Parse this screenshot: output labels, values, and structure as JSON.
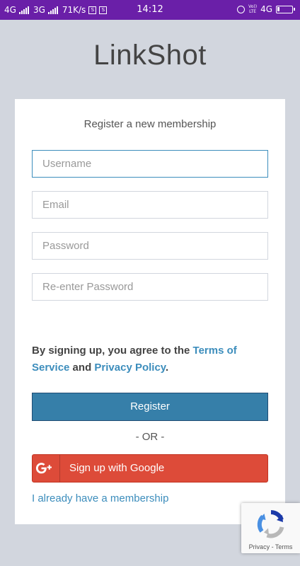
{
  "status_bar": {
    "network1": "4G",
    "network2": "3G",
    "speed": "71K/s",
    "time": "14:12",
    "volte_top": "Vo))",
    "volte_bottom": "LTE",
    "network3": "4G",
    "battery_fill_fraction": 0.15
  },
  "app": {
    "title": "LinkShot"
  },
  "register": {
    "heading": "Register a new membership",
    "username_placeholder": "Username",
    "email_placeholder": "Email",
    "password_placeholder": "Password",
    "reenter_password_placeholder": "Re-enter Password",
    "terms_prefix": "By signing up, you agree to the ",
    "terms_link": "Terms of Service",
    "terms_and": " and ",
    "privacy_link": "Privacy Policy",
    "terms_suffix": ".",
    "register_button": "Register",
    "or_separator": "- OR -",
    "google_button": "Sign up with Google",
    "membership_link": "I already have a membership"
  },
  "recaptcha": {
    "privacy": "Privacy",
    "separator": " - ",
    "terms": "Terms"
  },
  "colors": {
    "status_bar": "#6a1fa8",
    "page_background": "#d2d6de",
    "primary_button": "#367fa9",
    "google_button": "#dd4b39",
    "link": "#3c8dbc"
  }
}
